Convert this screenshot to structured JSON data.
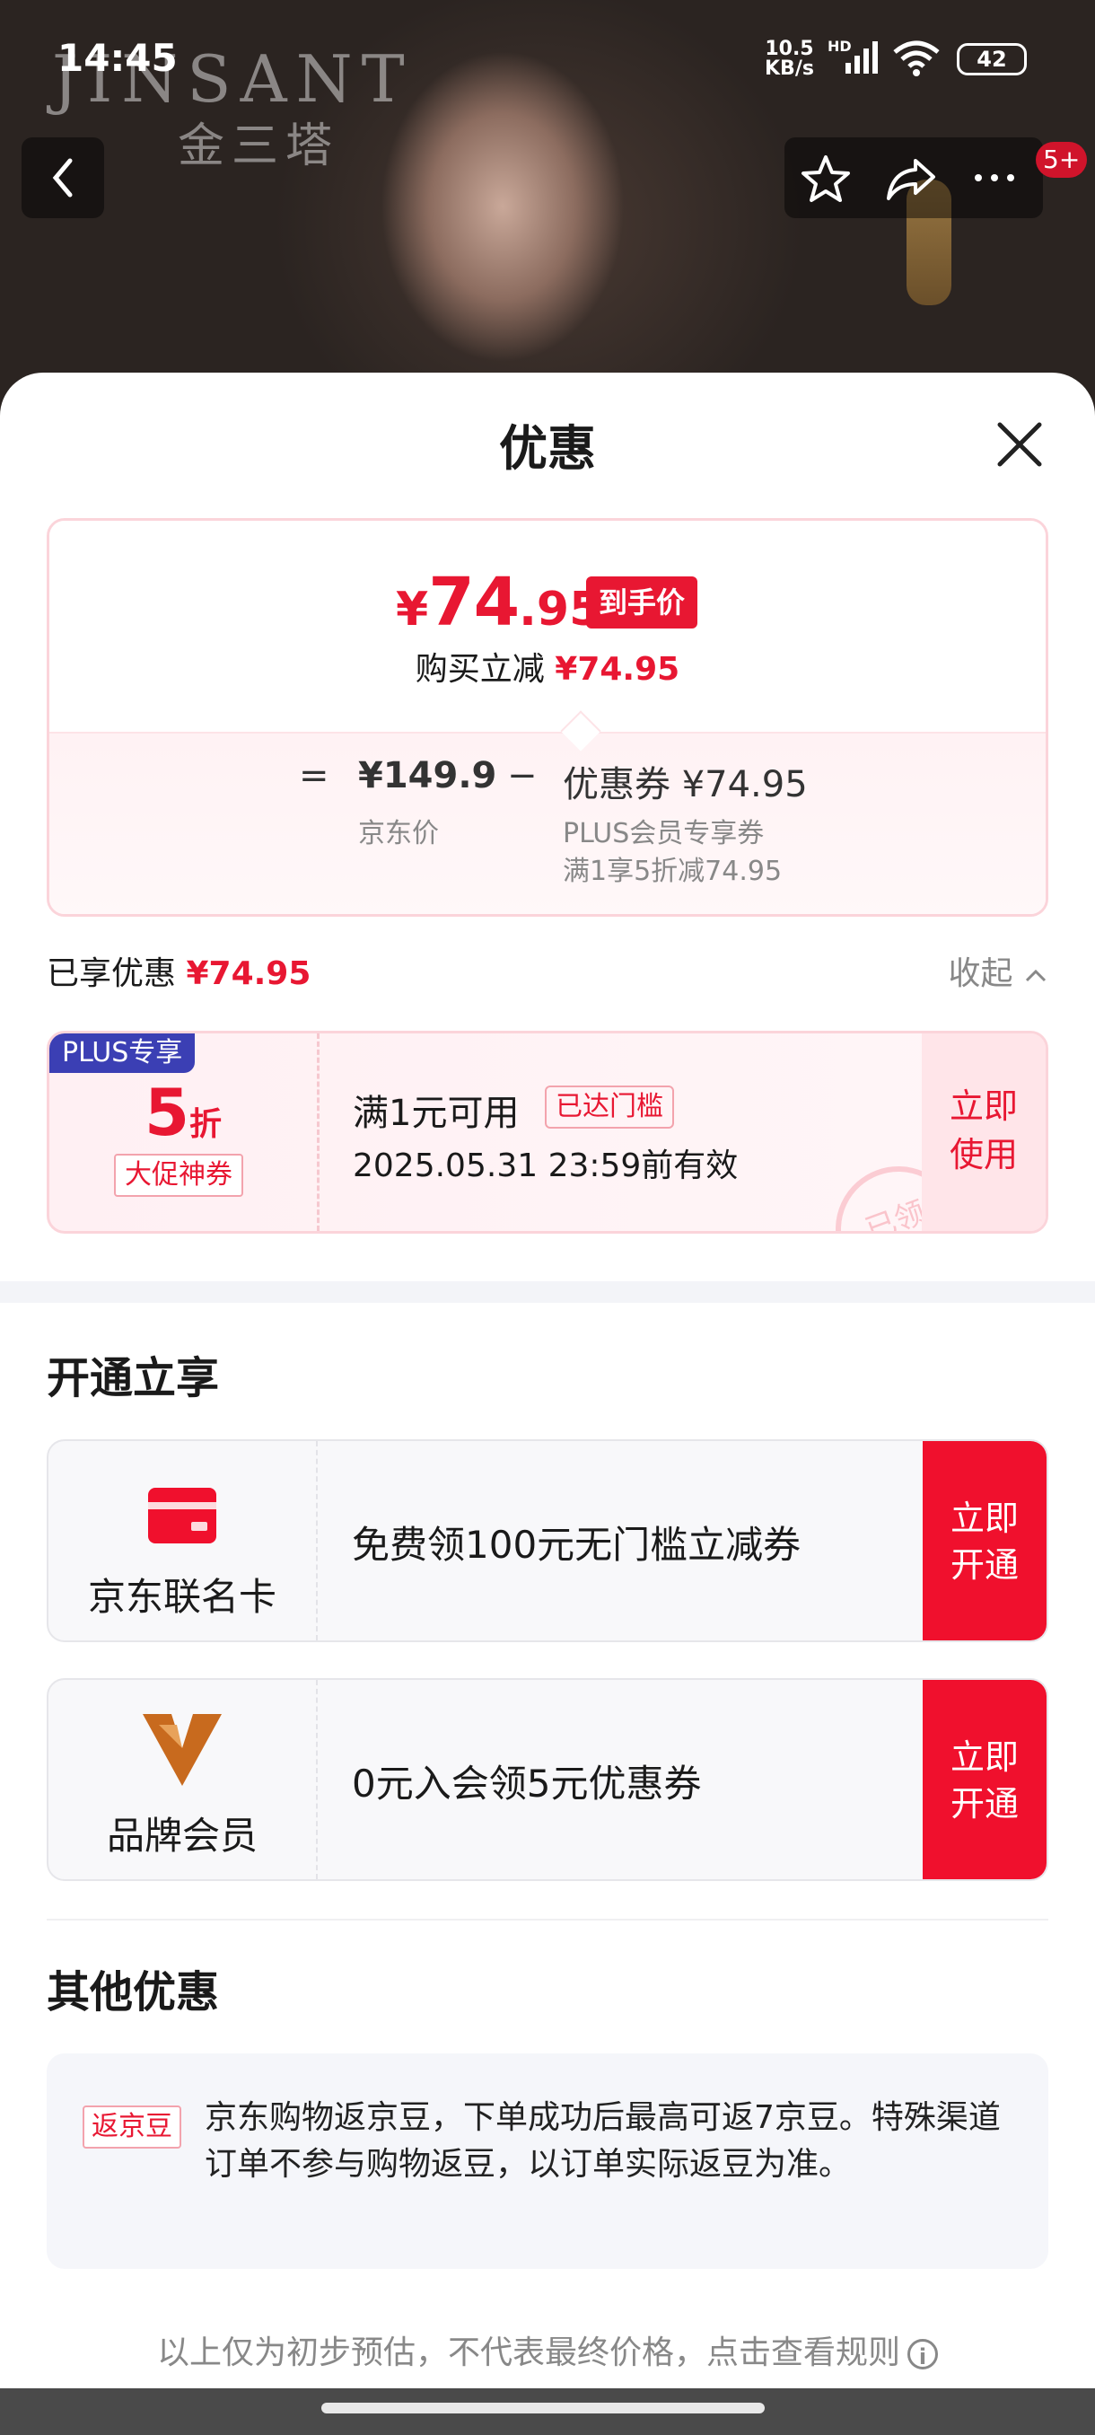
{
  "status_bar": {
    "time": "14:45",
    "net_speed": "10.5",
    "net_unit": "KB/s",
    "hd": "HD",
    "battery": "42"
  },
  "header": {
    "brand_en": "JINSANT",
    "brand_cn": "金三塔",
    "notif_badge": "5+"
  },
  "sheet": {
    "title": "优惠"
  },
  "price_summary": {
    "currency": "¥",
    "final_int": "74",
    "final_dec": ".95",
    "final_tag": "到手价",
    "reduce_label": "购买立减",
    "reduce_amount": "¥74.95",
    "eq": "=",
    "jd_price": "¥149.9",
    "jd_price_label": "京东价",
    "minus": "−",
    "coupon_price": "优惠券 ¥74.95",
    "coupon_sub1": "PLUS会员专享券",
    "coupon_sub2": "满1享5折减74.95"
  },
  "enjoyed": {
    "label": "已享优惠",
    "amount": "¥74.95",
    "collapse_label": "收起"
  },
  "coupon": {
    "plus_tag": "PLUS专享",
    "discount_num": "5",
    "discount_unit": "折",
    "promo_tag": "大促神券",
    "condition": "满1元可用",
    "reached_tag": "已达门槛",
    "validity": "2025.05.31 23:59前有效",
    "use_line1": "立即",
    "use_line2": "使用",
    "stamp": "已领"
  },
  "open_section": {
    "title": "开通立享",
    "items": [
      {
        "label": "京东联名卡",
        "desc": "免费领100元无门槛立减券",
        "btn1": "立即",
        "btn2": "开通"
      },
      {
        "label": "品牌会员",
        "desc": "0元入会领5元优惠券",
        "btn1": "立即",
        "btn2": "开通"
      }
    ]
  },
  "other_section": {
    "title": "其他优惠",
    "tag": "返京豆",
    "text": "京东购物返京豆，下单成功后最高可返7京豆。特殊渠道订单不参与购物返豆，以订单实际返豆为准。"
  },
  "footer": {
    "note": "以上仅为初步预估，不代表最终价格，点击查看规则",
    "info_icon": "i"
  },
  "colors": {
    "accent": "#e81732",
    "plus": "#3b3fb4",
    "button_red": "#f0102d"
  }
}
